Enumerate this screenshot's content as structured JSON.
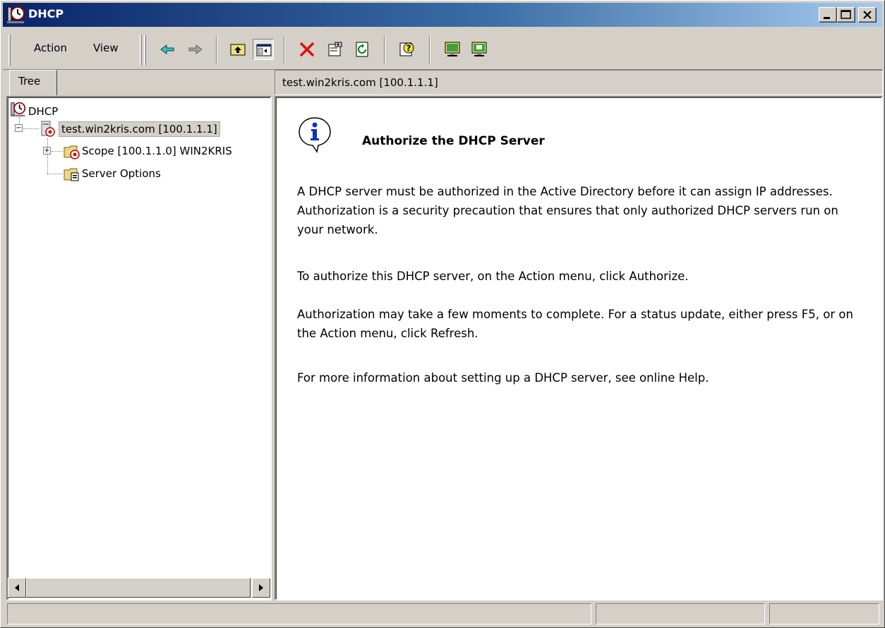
{
  "window": {
    "title": "DHCP",
    "minimize_icon": "minimize-icon",
    "maximize_icon": "maximize-icon",
    "close_icon": "close-icon"
  },
  "menu": {
    "items": [
      "Action",
      "View"
    ]
  },
  "toolbar": {
    "buttons": [
      {
        "icon": "back-arrow-icon"
      },
      {
        "icon": "forward-arrow-icon"
      },
      {
        "icon": "up-one-level-icon"
      },
      {
        "icon": "show-hide-console-tree-icon"
      },
      {
        "icon": "delete-icon"
      },
      {
        "icon": "properties-icon"
      },
      {
        "icon": "refresh-icon"
      },
      {
        "icon": "help-icon"
      },
      {
        "icon": "server-monitor-icon"
      },
      {
        "icon": "server-monitor-alt-icon"
      }
    ]
  },
  "tree": {
    "tab_label": "Tree",
    "nodes": [
      {
        "label": "DHCP",
        "icon": "dhcp-icon"
      },
      {
        "label": "test.win2kris.com [100.1.1.1]",
        "icon": "server-stopped-icon",
        "expander": "⊟"
      },
      {
        "label": "Scope [100.1.1.0] WIN2KRIS",
        "icon": "scope-folder-icon",
        "expander": "⊞"
      },
      {
        "label": "Server Options",
        "icon": "server-options-folder-icon"
      }
    ]
  },
  "right": {
    "header": "test.win2kris.com [100.1.1.1]",
    "title": "Authorize the DHCP Server",
    "paragraphs": [
      "A DHCP server must be authorized in the Active Directory before it can assign IP addresses. Authorization is a security precaution that ensures that only authorized DHCP servers run on your network.",
      "To authorize this DHCP server, on the Action menu, click Authorize.",
      "Authorization may take a few moments to complete. For a status update, either press F5, or on the Action menu, click Refresh.",
      "For more information about setting up a DHCP server, see online Help."
    ]
  },
  "colors": {
    "titlebar_start": "#0a246a",
    "titlebar_end": "#a6caf0",
    "face": "#d4d0c8"
  }
}
